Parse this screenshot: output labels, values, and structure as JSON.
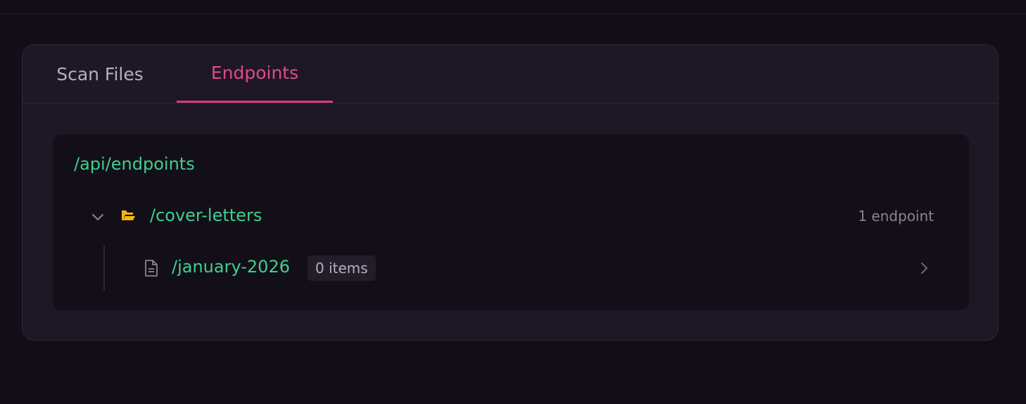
{
  "tabs": [
    {
      "label": "Scan Files",
      "active": false
    },
    {
      "label": "Endpoints",
      "active": true
    }
  ],
  "tree": {
    "root_path": "/api/endpoints",
    "folder": {
      "name": "/cover-letters",
      "expanded": true,
      "count_label": "1 endpoint",
      "icon": "folder-open-icon"
    },
    "file": {
      "name": "/january-2026",
      "badge": "0 items",
      "icon": "file-text-icon"
    }
  },
  "colors": {
    "accent_pink": "#e0488c",
    "path_green": "#3fcf8e",
    "folder_yellow": "#f2b512",
    "background": "#120e17"
  }
}
